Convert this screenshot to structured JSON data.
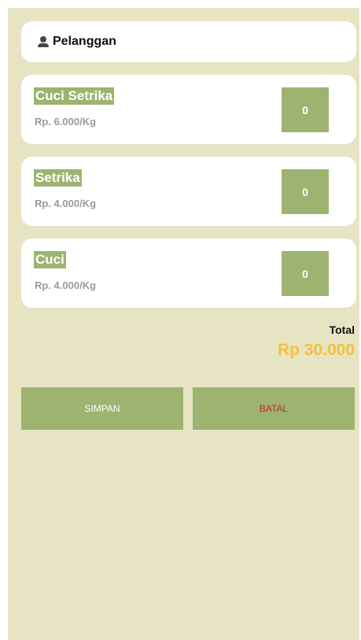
{
  "customer": {
    "label": "Pelanggan",
    "icon": "person-icon"
  },
  "services": [
    {
      "name": "Cuci Setrika",
      "price": "Rp. 6.000/Kg",
      "quantity": "0"
    },
    {
      "name": "Setrika",
      "price": "Rp. 4.000/Kg",
      "quantity": "0"
    },
    {
      "name": "Cuci",
      "price": "Rp. 4.000/Kg",
      "quantity": "0"
    }
  ],
  "total": {
    "label": "Total",
    "value": "Rp 30.000"
  },
  "actions": {
    "save_label": "SIMPAN",
    "cancel_label": "BATAL"
  },
  "colors": {
    "background": "#e6e4c3",
    "accent": "#9cb470",
    "total": "#f4c13a",
    "cancel_text": "#c62828"
  }
}
